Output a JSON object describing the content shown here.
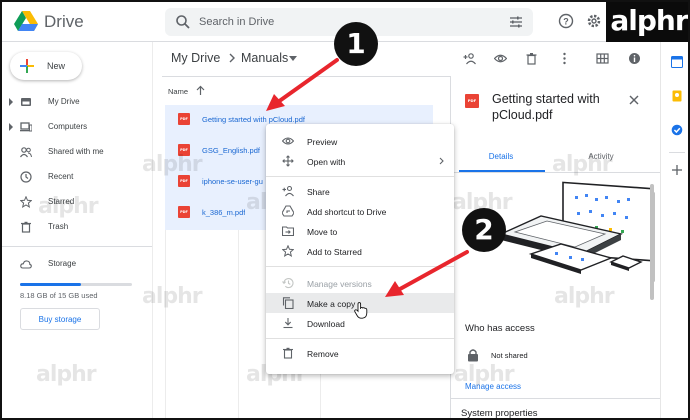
{
  "app": {
    "title": "Drive"
  },
  "search": {
    "placeholder": "Search in Drive"
  },
  "brand": {
    "overlay": "alphr",
    "watermark": "alphr"
  },
  "sidebar": {
    "new_label": "New",
    "items": [
      {
        "label": "My Drive",
        "icon": "drive-icon",
        "has_caret": true
      },
      {
        "label": "Computers",
        "icon": "computer-icon",
        "has_caret": true
      },
      {
        "label": "Shared with me",
        "icon": "people-icon",
        "has_caret": false
      },
      {
        "label": "Recent",
        "icon": "clock-icon",
        "has_caret": false
      },
      {
        "label": "Starred",
        "icon": "star-icon",
        "has_caret": false
      },
      {
        "label": "Trash",
        "icon": "trash-icon",
        "has_caret": false
      }
    ],
    "storage": {
      "label": "Storage",
      "used_text": "8.18 GB of 15 GB used",
      "used_fraction": 0.545,
      "buy_label": "Buy storage"
    }
  },
  "breadcrumb": {
    "root": "My Drive",
    "current": "Manuals"
  },
  "file_list": {
    "column_header": "Name",
    "sort": "ascending",
    "files": [
      {
        "name": "Getting started with pCloud.pdf",
        "type": "PDF"
      },
      {
        "name": "GSG_English.pdf",
        "type": "PDF"
      },
      {
        "name": "iphone-se-user-gu",
        "type": "PDF"
      },
      {
        "name": "k_386_m.pdf",
        "type": "PDF"
      }
    ]
  },
  "context_menu": {
    "groups": [
      [
        {
          "label": "Preview",
          "icon": "eye-icon"
        },
        {
          "label": "Open with",
          "icon": "open-with-icon",
          "submenu": true
        }
      ],
      [
        {
          "label": "Share",
          "icon": "person-add-icon"
        },
        {
          "label": "Add shortcut to Drive",
          "icon": "shortcut-icon"
        },
        {
          "label": "Move to",
          "icon": "move-icon"
        },
        {
          "label": "Add to Starred",
          "icon": "star-icon"
        }
      ],
      [
        {
          "label": "Manage versions",
          "icon": "history-icon",
          "disabled": true
        },
        {
          "label": "Make a copy",
          "icon": "copy-icon",
          "hovered": true
        },
        {
          "label": "Download",
          "icon": "download-icon"
        }
      ],
      [
        {
          "label": "Remove",
          "icon": "trash-icon"
        }
      ]
    ]
  },
  "details_panel": {
    "file_type": "PDF",
    "title": "Getting started with pCloud.pdf",
    "tabs": {
      "details": "Details",
      "activity": "Activity"
    },
    "access_title": "Who has access",
    "access_status": "Not shared",
    "manage_access": "Manage access",
    "system_properties": "System properties"
  },
  "annotations": {
    "step1": "1",
    "step2": "2"
  },
  "colors": {
    "accent": "#1a73e8",
    "selection": "#e8f0fe",
    "pdf": "#ea4335",
    "annotation_arrow": "#e8262d"
  }
}
